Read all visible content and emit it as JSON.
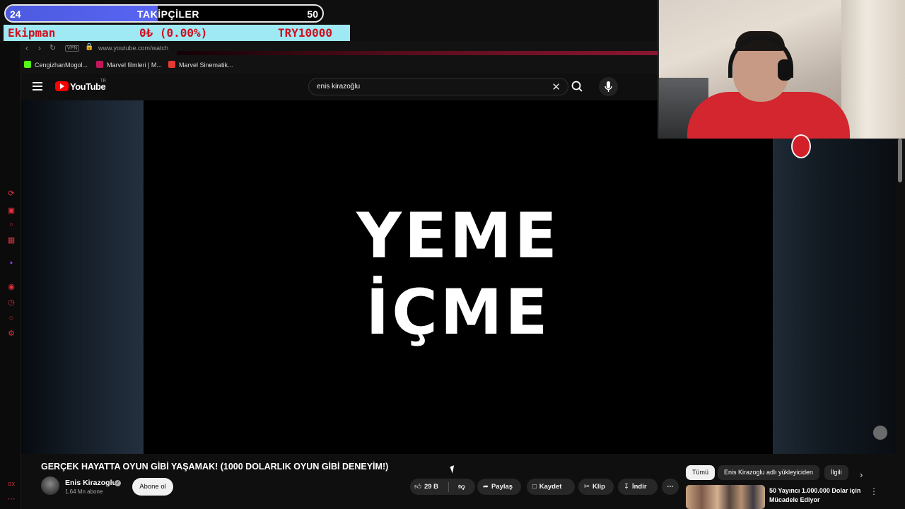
{
  "overlay": {
    "followers": {
      "current": "24",
      "label": "TAKİPÇİLER",
      "goal": "50",
      "progress": 0.48
    },
    "equipment": {
      "label": "Ekipman",
      "amount": "0₺ (0.00%)",
      "target": "TRY10000"
    }
  },
  "browser": {
    "url": "www.youtube.com/watch",
    "vpn_label": "VPN",
    "bookmarks": [
      {
        "label": "CengizhanMogol...",
        "color": "#53fc18"
      },
      {
        "label": "Marvel filmleri | M...",
        "color": "#c2185b"
      },
      {
        "label": "Marvel Sinematik...",
        "color": "#e53935"
      }
    ]
  },
  "youtube": {
    "logo_text": "YouTube",
    "region": "TR",
    "search_query": "enis kirazoğlu",
    "video": {
      "overlay_line1": "YEME",
      "overlay_line2": "İÇME"
    },
    "title": "GERÇEK HAYATTA OYUN GİBİ YAŞAMAK! (1000 DOLARLIK OYUN GİBİ DENEYİM!)",
    "channel": {
      "name": "Enis Kirazoglu",
      "subscribers": "1,64 Mn abone",
      "subscribe_label": "Abone ol"
    },
    "actions": {
      "likes": "29 B",
      "share": "Paylaş",
      "save": "Kaydet",
      "clip": "Klip",
      "download": "İndir"
    },
    "chips": [
      "Tümü",
      "Enis Kirazoglu adlı yükleyiciden",
      "İlgili"
    ],
    "recommendation": {
      "title": "50 Yayıncı 1.000.000 Dolar için Mücadele Ediyor"
    }
  }
}
